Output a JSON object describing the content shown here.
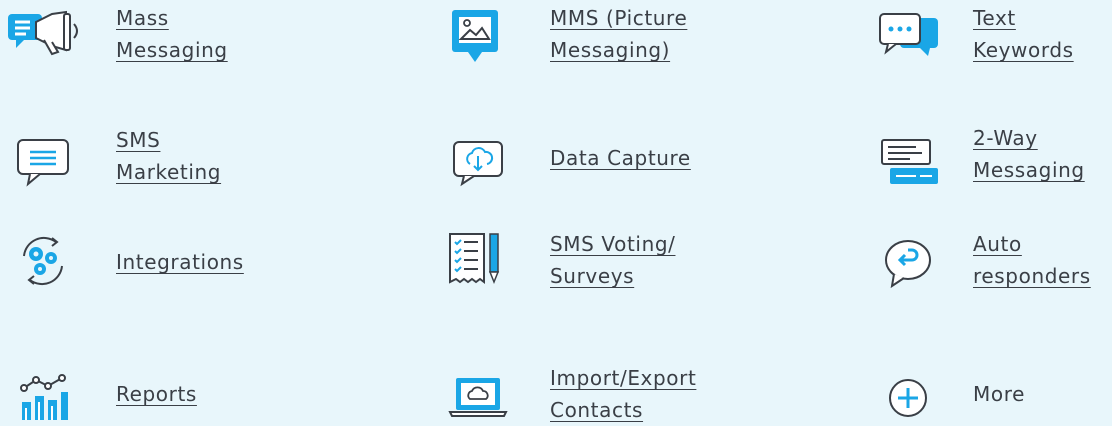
{
  "features": [
    {
      "label": "Mass\nMessaging",
      "icon": "megaphone-icon"
    },
    {
      "label": "MMS (Picture\nMessaging)",
      "icon": "picture-message-icon"
    },
    {
      "label": "Text\nKeywords",
      "icon": "chat-bubbles-icon"
    },
    {
      "label": "SMS\nMarketing",
      "icon": "message-bubble-icon"
    },
    {
      "label": "Data Capture",
      "icon": "cloud-download-bubble-icon"
    },
    {
      "label": "2-Way\nMessaging",
      "icon": "two-way-messages-icon"
    },
    {
      "label": "Integrations",
      "icon": "gears-sync-icon"
    },
    {
      "label": "SMS Voting/\nSurveys",
      "icon": "checklist-pencil-icon"
    },
    {
      "label": "Auto\nresponders",
      "icon": "reply-bubble-icon"
    },
    {
      "label": "Reports",
      "icon": "bar-chart-icon"
    },
    {
      "label": "Import/Export\nContacts",
      "icon": "laptop-cloud-icon"
    },
    {
      "label": "More",
      "icon": "plus-circle-icon"
    }
  ],
  "colors": {
    "accent": "#1aa6e6",
    "outline": "#3a3f46",
    "background": "#e8f6fb"
  }
}
